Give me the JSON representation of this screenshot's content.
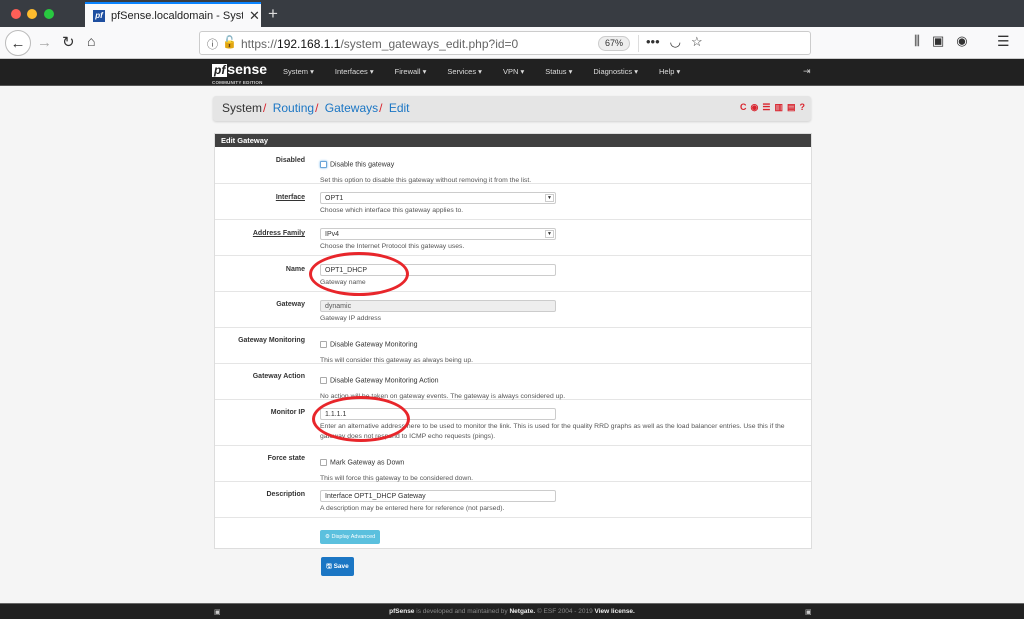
{
  "browser": {
    "tab_title": "pfSense.localdomain - System: Routing: Gateways: Edit",
    "tab_favicon": "pf",
    "url_prefix": "https://",
    "url_host": "192.168.1.1",
    "url_path": "/system_gateways_edit.php?id=0",
    "zoom": "67%",
    "new_tab": "+",
    "more": "•••"
  },
  "nav": {
    "logo_pf": "pf",
    "logo_sense": "sense",
    "logo_edition": "COMMUNITY EDITION",
    "menu": [
      "System ▾",
      "Interfaces ▾",
      "Firewall ▾",
      "Services ▾",
      "VPN ▾",
      "Status ▾",
      "Diagnostics ▾",
      "Help ▾"
    ]
  },
  "breadcrumb": {
    "items": [
      "System",
      "Routing",
      "Gateways",
      "Edit"
    ],
    "separator": "/"
  },
  "panel": {
    "title": "Edit Gateway",
    "disabled": {
      "label": "Disabled",
      "checkbox_label": "Disable this gateway",
      "checked": false,
      "help": "Set this option to disable this gateway without removing it from the list."
    },
    "interface": {
      "label": "Interface",
      "value": "OPT1",
      "help": "Choose which interface this gateway applies to."
    },
    "address_family": {
      "label": "Address Family",
      "value": "IPv4",
      "help": "Choose the Internet Protocol this gateway uses."
    },
    "name": {
      "label": "Name",
      "value": "OPT1_DHCP",
      "help": "Gateway name"
    },
    "gateway": {
      "label": "Gateway",
      "value": "dynamic",
      "help": "Gateway IP address"
    },
    "gateway_monitoring": {
      "label": "Gateway Monitoring",
      "checkbox_label": "Disable Gateway Monitoring",
      "checked": false,
      "help": "This will consider this gateway as always being up."
    },
    "gateway_action": {
      "label": "Gateway Action",
      "checkbox_label": "Disable Gateway Monitoring Action",
      "checked": false,
      "help": "No action will be taken on gateway events. The gateway is always considered up."
    },
    "monitor_ip": {
      "label": "Monitor IP",
      "value": "1.1.1.1",
      "help": "Enter an alternative address here to be used to monitor the link. This is used for the quality RRD graphs as well as the load balancer entries. Use this if the gateway does not respond to ICMP echo requests (pings)."
    },
    "force_state": {
      "label": "Force state",
      "checkbox_label": "Mark Gateway as Down",
      "checked": false,
      "help": "This will force this gateway to be considered down."
    },
    "description": {
      "label": "Description",
      "value": "Interface OPT1_DHCP Gateway",
      "help": "A description may be entered here for reference (not parsed)."
    },
    "advanced_button": "Display Advanced"
  },
  "save_button": "Save",
  "footer": {
    "brand": "pfSense",
    "text1": " is developed and maintained by ",
    "company": "Netgate.",
    "text2": " © ESF 2004 - 2019 ",
    "license": "View license."
  },
  "colors": {
    "accent": "#1b76c4",
    "danger": "#d9232d",
    "info": "#5bc0de",
    "navbar": "#212121"
  }
}
